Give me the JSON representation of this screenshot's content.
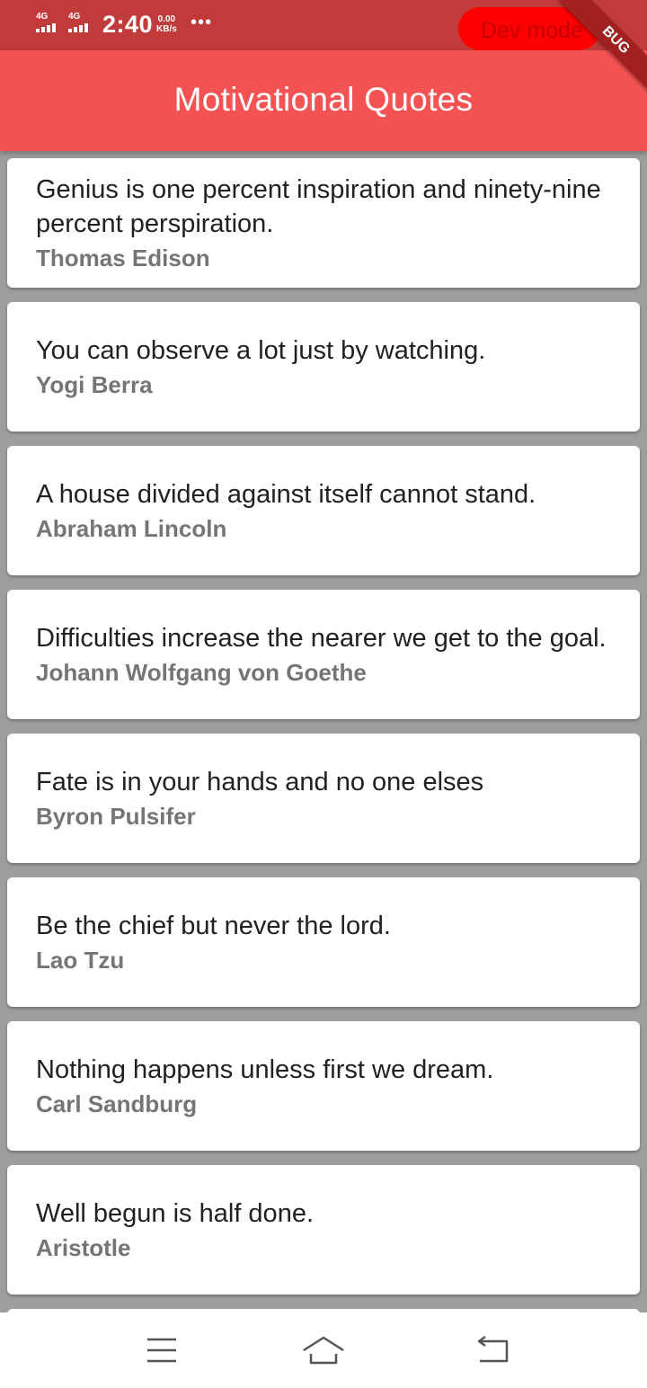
{
  "status_bar": {
    "signal1": "4G",
    "signal2": "4G",
    "time": "2:40",
    "net_speed_value": "0.00",
    "net_speed_unit": "KB/s",
    "overflow": "•••",
    "dev_mode_label": "Dev mode"
  },
  "app_bar": {
    "title": "Motivational Quotes",
    "debug_ribbon": "BUG"
  },
  "quotes": [
    {
      "text": "Genius is one percent inspiration and ninety-nine percent perspiration.",
      "author": "Thomas Edison"
    },
    {
      "text": "You can observe a lot just by watching.",
      "author": "Yogi Berra"
    },
    {
      "text": "A house divided against itself cannot stand.",
      "author": "Abraham Lincoln"
    },
    {
      "text": "Difficulties increase the nearer we get to the goal.",
      "author": "Johann Wolfgang von Goethe"
    },
    {
      "text": "Fate is in your hands and no one elses",
      "author": "Byron Pulsifer"
    },
    {
      "text": "Be the chief but never the lord.",
      "author": "Lao Tzu"
    },
    {
      "text": "Nothing happens unless first we dream.",
      "author": "Carl Sandburg"
    },
    {
      "text": "Well begun is half done.",
      "author": "Aristotle"
    }
  ],
  "nav": {
    "icons": [
      "menu-icon",
      "home-icon",
      "back-icon"
    ]
  },
  "colors": {
    "status_bar": "#c23b3b",
    "app_bar": "#f55353",
    "list_background": "#9e9e9e",
    "card": "#ffffff",
    "author_text": "#757575",
    "dev_pill": "#ff0000"
  }
}
